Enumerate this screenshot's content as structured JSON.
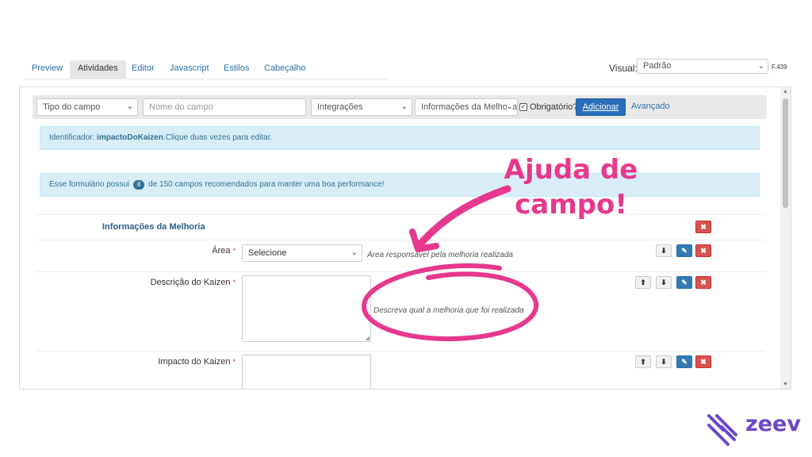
{
  "tabs": [
    {
      "label": "Preview",
      "active": false
    },
    {
      "label": "Atividades",
      "active": true
    },
    {
      "label": "Editor",
      "active": false
    },
    {
      "label": "Javascript",
      "active": false
    },
    {
      "label": "Estilos",
      "active": false
    },
    {
      "label": "Cabeçalho",
      "active": false
    }
  ],
  "visual": {
    "label": "Visual:",
    "value": "Padrão",
    "form_code": "F.439"
  },
  "toolbar": {
    "field_type": "Tipo do campo",
    "field_name_placeholder": "Nome do campo",
    "integrations": "Integrações",
    "section": "Informações da Melhoria",
    "required_label": "Obrigatório?",
    "add_label": "Adicionar",
    "advanced_label": "Avançado"
  },
  "info_identifier": {
    "prefix": "Identificador:",
    "id": "impactoDoKaizen",
    "suffix": ".Clique duas vezes para editar."
  },
  "info_performance": {
    "prefix": "Esse formulário possui",
    "count": "8",
    "suffix": "de 150 campos recomendados para manter uma boa performance!"
  },
  "section": {
    "title": "Informações da Melhoria"
  },
  "fields": [
    {
      "label": "Área",
      "required": "*",
      "value": "Selecione",
      "help": "Área responsável pela melhoria realizada"
    },
    {
      "label": "Descrição do Kaizen",
      "required": "*",
      "help": "Descreva qual a melhoria que foi realizada"
    },
    {
      "label": "Impacto do Kaizen",
      "required": "*",
      "help": ""
    }
  ],
  "annotation": {
    "line1": "Ajuda de",
    "line2": "campo!",
    "color": "#e7388d"
  },
  "brand": {
    "name": "zeev",
    "color": "#6b48c8"
  },
  "colors": {
    "primary": "#2a6ebb",
    "info_bg": "#d9edf7",
    "danger": "#d9534f"
  }
}
